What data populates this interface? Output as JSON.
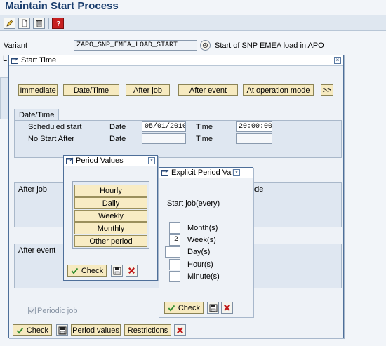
{
  "page_title": "Maintain Start Process",
  "variant": {
    "label": "Variant",
    "value": "ZAPO_SNP_EMEA_LOAD_START",
    "description": "Start of SNP EMEA load in APO"
  },
  "background_truncated_label": "L",
  "start_time_window": {
    "title": "Start Time",
    "buttons": {
      "immediate": "Immediate",
      "date_time": "Date/Time",
      "after_job": "After job",
      "after_event": "After event",
      "at_operation_mode": "At operation mode",
      "more": ">>"
    },
    "date_time_group": {
      "tab": "Date/Time",
      "scheduled_start_label": "Scheduled start",
      "no_start_after_label": "No Start After",
      "date_label": "Date",
      "time_label": "Time",
      "scheduled_date": "05/01/2010",
      "scheduled_time": "20:00:00"
    },
    "after_job_label": "After job",
    "truncated_label": "ode",
    "after_event_label": "After event",
    "periodic_job_label": "Periodic job",
    "footer": {
      "check": "Check",
      "period_values": "Period values",
      "restrictions": "Restrictions"
    }
  },
  "period_values_window": {
    "title": "Period Values",
    "options": [
      "Hourly",
      "Daily",
      "Weekly",
      "Monthly",
      "Other period"
    ],
    "check": "Check"
  },
  "explicit_period_window": {
    "title": "Explicit Period Val",
    "start_label": "Start job(every)",
    "rows": [
      {
        "label": "Month(s)",
        "value": ""
      },
      {
        "label": "Week(s)",
        "value": "2"
      },
      {
        "label": "Day(s)",
        "value": ""
      },
      {
        "label": "Hour(s)",
        "value": ""
      },
      {
        "label": "Minute(s)",
        "value": ""
      }
    ],
    "check": "Check"
  },
  "icons": [
    "edit-icon",
    "new-icon",
    "delete-icon",
    "help-icon",
    "choose-icon",
    "window-icon",
    "close-icon",
    "check-icon",
    "save-icon",
    "cancel-icon"
  ],
  "colors": {
    "title": "#1a3e6e",
    "button_fill": "#f6eac0",
    "panel_fill": "#dfe7f1",
    "check_green": "#2e8b2e",
    "cancel_red": "#c01818"
  }
}
